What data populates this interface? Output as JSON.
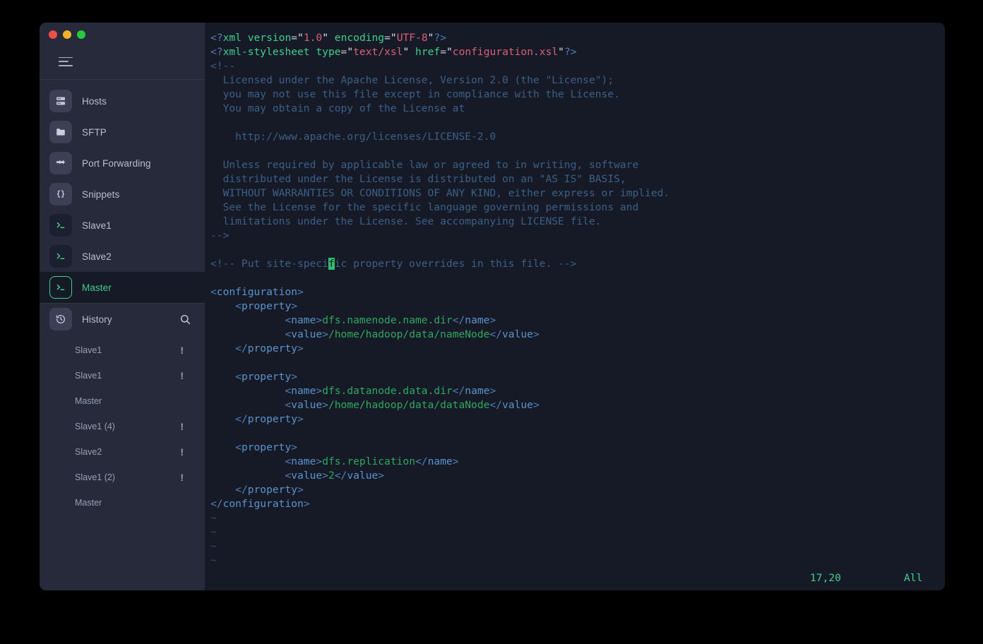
{
  "window": {
    "traffic_lights": [
      "close",
      "minimize",
      "maximize"
    ],
    "menu_icon": "hamburger-icon"
  },
  "sidebar": {
    "nav": [
      {
        "label": "Hosts",
        "icon": "server-icon",
        "active": false
      },
      {
        "label": "SFTP",
        "icon": "folder-icon",
        "active": false
      },
      {
        "label": "Port Forwarding",
        "icon": "forward-arrows-icon",
        "active": false
      },
      {
        "label": "Snippets",
        "icon": "braces-icon",
        "active": false
      },
      {
        "label": "Slave1",
        "icon": "terminal-icon",
        "active": false
      },
      {
        "label": "Slave2",
        "icon": "terminal-icon",
        "active": false
      },
      {
        "label": "Master",
        "icon": "terminal-icon",
        "active": true
      }
    ],
    "history": {
      "label": "History",
      "icon": "history-clock-icon",
      "search_icon": "search-icon",
      "items": [
        {
          "label": "Slave1",
          "badge": "!"
        },
        {
          "label": "Slave1",
          "badge": "!"
        },
        {
          "label": "Master",
          "badge": ""
        },
        {
          "label": "Slave1 (4)",
          "badge": "!"
        },
        {
          "label": "Slave2",
          "badge": "!"
        },
        {
          "label": "Slave1 (2)",
          "badge": "!"
        },
        {
          "label": "Master",
          "badge": ""
        }
      ]
    }
  },
  "terminal": {
    "editor": "vim",
    "file_lines": [
      "<?xml version=\"1.0\" encoding=\"UTF-8\"?>",
      "<?xml-stylesheet type=\"text/xsl\" href=\"configuration.xsl\"?>",
      "<!--",
      "  Licensed under the Apache License, Version 2.0 (the \"License\");",
      "  you may not use this file except in compliance with the License.",
      "  You may obtain a copy of the License at",
      "",
      "    http://www.apache.org/licenses/LICENSE-2.0",
      "",
      "  Unless required by applicable law or agreed to in writing, software",
      "  distributed under the License is distributed on an \"AS IS\" BASIS,",
      "  WITHOUT WARRANTIES OR CONDITIONS OF ANY KIND, either express or implied.",
      "  See the License for the specific language governing permissions and",
      "  limitations under the License. See accompanying LICENSE file.",
      "-->",
      "",
      "<!-- Put site-specific property overrides in this file. -->",
      "",
      "<configuration>",
      "    <property>",
      "            <name>dfs.namenode.name.dir</name>",
      "            <value>/home/hadoop/data/nameNode</value>",
      "    </property>",
      "",
      "    <property>",
      "            <name>dfs.datanode.data.dir</name>",
      "            <value>/home/hadoop/data/dataNode</value>",
      "    </property>",
      "",
      "    <property>",
      "            <name>dfs.replication</name>",
      "            <value>2</value>",
      "    </property>",
      "</configuration>",
      "~",
      "~",
      "~",
      "~"
    ],
    "cursor": {
      "line": 17,
      "column": 20,
      "char": "f"
    },
    "statusbar": {
      "position": "17,20",
      "scroll": "All"
    },
    "colors": {
      "background": "#161a26",
      "comment": "#3c5f85",
      "tag": "#5b93cc",
      "text": "#2fa85f",
      "string": "#d9607a",
      "accent_green": "#3fcf8e",
      "cursor": "#2fbf70"
    }
  }
}
